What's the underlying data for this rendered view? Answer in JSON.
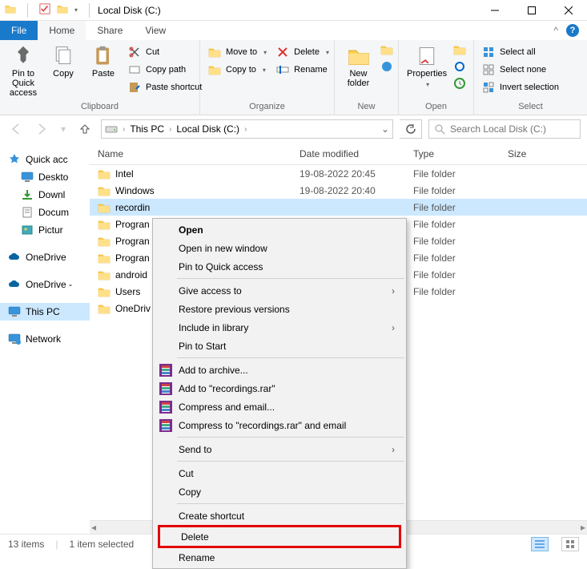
{
  "titlebar": {
    "title": "Local Disk (C:)"
  },
  "tabs": {
    "file": "File",
    "home": "Home",
    "share": "Share",
    "view": "View"
  },
  "ribbon": {
    "pin_to_quick_access": "Pin to Quick access",
    "copy": "Copy",
    "paste": "Paste",
    "cut": "Cut",
    "copy_path": "Copy path",
    "paste_shortcut": "Paste shortcut",
    "clipboard_label": "Clipboard",
    "move_to": "Move to",
    "copy_to": "Copy to",
    "delete": "Delete",
    "rename": "Rename",
    "organize_label": "Organize",
    "new_folder": "New folder",
    "new_label": "New",
    "properties": "Properties",
    "open_label": "Open",
    "select_all": "Select all",
    "select_none": "Select none",
    "invert_selection": "Invert selection",
    "select_label": "Select"
  },
  "breadcrumb": {
    "this_pc": "This PC",
    "drive": "Local Disk (C:)"
  },
  "search": {
    "placeholder": "Search Local Disk (C:)"
  },
  "columns": {
    "name": "Name",
    "date": "Date modified",
    "type": "Type",
    "size": "Size"
  },
  "nav": {
    "quick_access": "Quick acc",
    "desktop": "Deskto",
    "downloads": "Downl",
    "documents": "Docum",
    "pictures": "Pictur",
    "onedrive": "OneDrive",
    "onedrive2": "OneDrive -",
    "this_pc": "This PC",
    "network": "Network"
  },
  "rows": [
    {
      "name": "Intel",
      "date": "19-08-2022 20:45",
      "type": "File folder"
    },
    {
      "name": "Windows",
      "date": "19-08-2022 20:40",
      "type": "File folder"
    },
    {
      "name": "recordin",
      "date": "",
      "type": "File folder",
      "selected": true
    },
    {
      "name": "Progran",
      "date": "",
      "type": "File folder"
    },
    {
      "name": "Progran",
      "date": "",
      "type": "File folder"
    },
    {
      "name": "Progran",
      "date": "",
      "type": "File folder"
    },
    {
      "name": "android",
      "date": "",
      "type": "File folder"
    },
    {
      "name": "Users",
      "date": "",
      "type": "File folder"
    },
    {
      "name": "OneDriv",
      "date": "",
      "type": ""
    }
  ],
  "context": {
    "open": "Open",
    "open_new": "Open in new window",
    "pin_qa": "Pin to Quick access",
    "give_access": "Give access to",
    "restore": "Restore previous versions",
    "include_lib": "Include in library",
    "pin_start": "Pin to Start",
    "add_archive": "Add to archive...",
    "add_rar": "Add to \"recordings.rar\"",
    "compress_email": "Compress and email...",
    "compress_rar_email": "Compress to \"recordings.rar\" and email",
    "send_to": "Send to",
    "cut": "Cut",
    "copy": "Copy",
    "create_shortcut": "Create shortcut",
    "delete": "Delete",
    "rename": "Rename"
  },
  "status": {
    "items": "13 items",
    "selected": "1 item selected"
  }
}
